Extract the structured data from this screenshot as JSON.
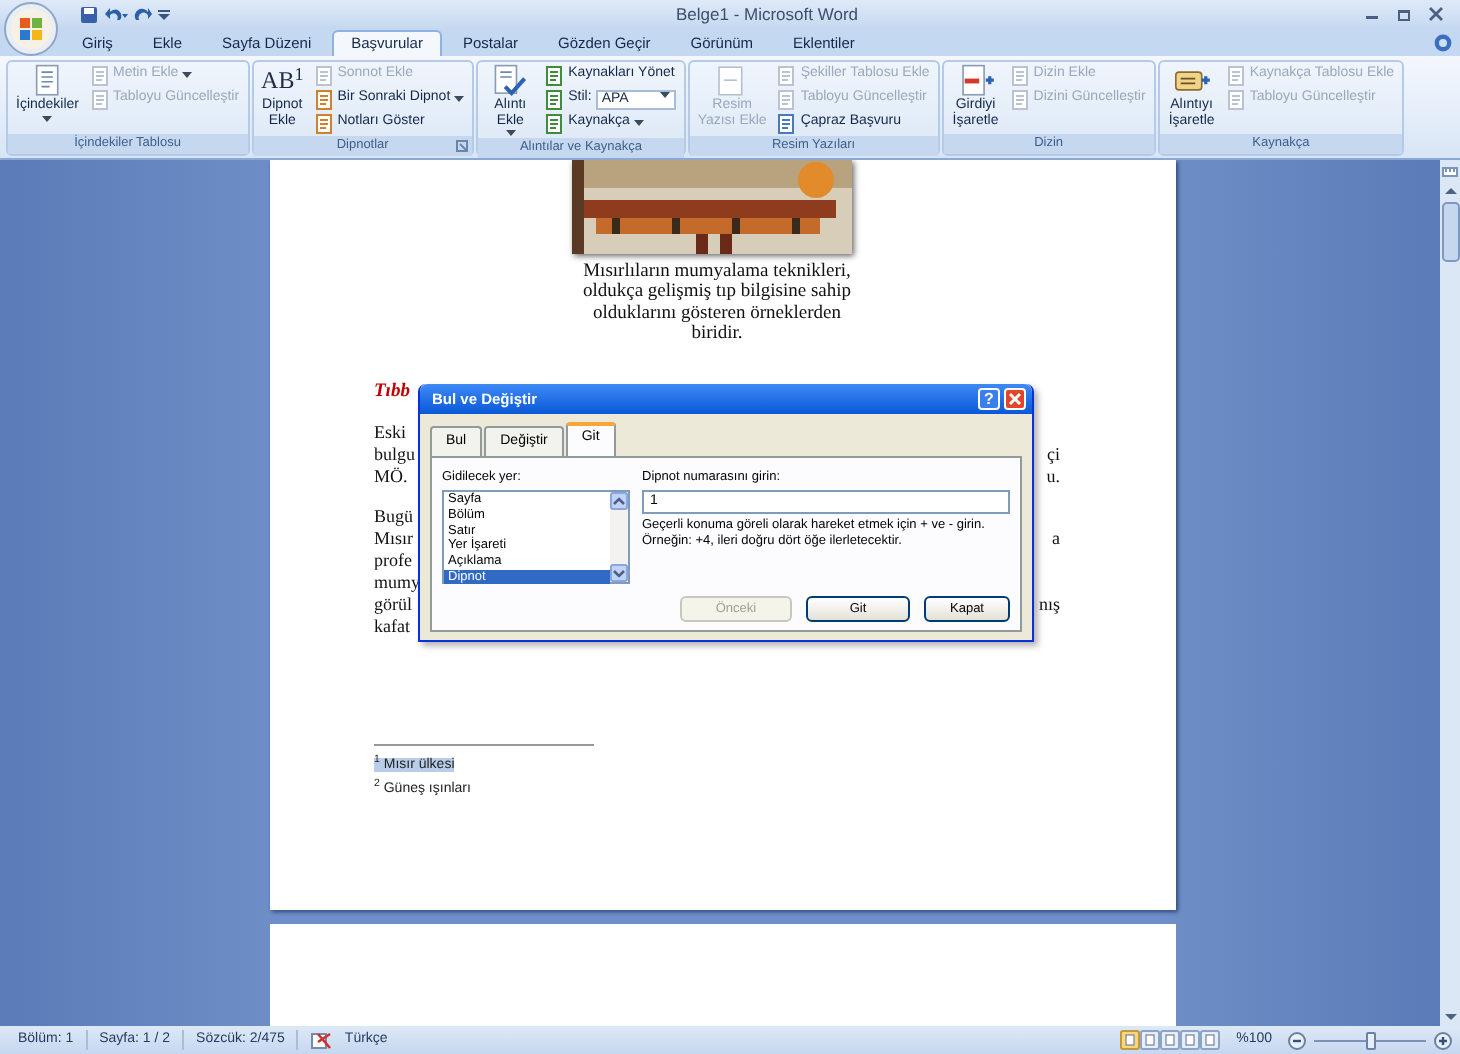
{
  "window": {
    "title": "Belge1 - Microsoft Word"
  },
  "tabs": [
    {
      "label": "Giriş",
      "selected": false
    },
    {
      "label": "Ekle",
      "selected": false
    },
    {
      "label": "Sayfa Düzeni",
      "selected": false
    },
    {
      "label": "Başvurular",
      "selected": true
    },
    {
      "label": "Postalar",
      "selected": false
    },
    {
      "label": "Gözden Geçir",
      "selected": false
    },
    {
      "label": "Görünüm",
      "selected": false
    },
    {
      "label": "Eklentiler",
      "selected": false
    }
  ],
  "ribbon": {
    "groups": [
      {
        "label": "İçindekiler Tablosu",
        "launcher": false,
        "items": [
          {
            "kind": "large",
            "lines": [
              "İçindekiler"
            ],
            "dropdown": true,
            "disabled": false
          },
          {
            "kind": "small",
            "label": "Metin Ekle",
            "dropdown": true,
            "disabled": true
          },
          {
            "kind": "small",
            "label": "Tabloyu Güncelleştir",
            "dropdown": false,
            "disabled": true
          }
        ]
      },
      {
        "label": "Dipnotlar",
        "launcher": true,
        "items": [
          {
            "kind": "large",
            "icon_text": "AB$^{1}$",
            "lines": [
              "Dipnot",
              "Ekle"
            ],
            "dropdown": false,
            "disabled": false
          },
          {
            "kind": "small",
            "label": "Sonnot Ekle",
            "dropdown": false,
            "disabled": true
          },
          {
            "kind": "small",
            "label": "Bir Sonraki Dipnot",
            "dropdown": true,
            "disabled": false
          },
          {
            "kind": "small",
            "label": "Notları Göster",
            "dropdown": false,
            "disabled": false
          }
        ]
      },
      {
        "label": "Alıntılar ve Kaynakça",
        "launcher": false,
        "items": [
          {
            "kind": "large",
            "lines": [
              "Alıntı",
              "Ekle"
            ],
            "dropdown": true,
            "disabled": false
          },
          {
            "kind": "small",
            "label": "Kaynakları Yönet",
            "dropdown": false,
            "disabled": false
          },
          {
            "kind": "combo",
            "label": "Stil:",
            "value": "APA",
            "disabled": false
          },
          {
            "kind": "small",
            "label": "Kaynakça",
            "dropdown": true,
            "disabled": false
          }
        ]
      },
      {
        "label": "Resim Yazıları",
        "launcher": false,
        "items": [
          {
            "kind": "large",
            "lines": [
              "Resim",
              "Yazısı Ekle"
            ],
            "dropdown": false,
            "disabled": true
          },
          {
            "kind": "small",
            "label": "Şekiller Tablosu Ekle",
            "dropdown": false,
            "disabled": true
          },
          {
            "kind": "small",
            "label": "Tabloyu Güncelleştir",
            "dropdown": false,
            "disabled": true
          },
          {
            "kind": "small",
            "label": "Çapraz Başvuru",
            "dropdown": false,
            "disabled": false
          }
        ]
      },
      {
        "label": "Dizin",
        "launcher": false,
        "items": [
          {
            "kind": "large",
            "lines": [
              "Girdiyi",
              "İşaretle"
            ],
            "dropdown": false,
            "disabled": false
          },
          {
            "kind": "small",
            "label": "Dizin Ekle",
            "dropdown": false,
            "disabled": true
          },
          {
            "kind": "small",
            "label": "Dizini Güncelleştir",
            "dropdown": false,
            "disabled": true
          }
        ]
      },
      {
        "label": "Kaynakça",
        "launcher": false,
        "items": [
          {
            "kind": "large",
            "lines": [
              "Alıntıyı",
              "İşaretle"
            ],
            "dropdown": false,
            "disabled": false
          },
          {
            "kind": "small",
            "label": "Kaynakça Tablosu Ekle",
            "dropdown": false,
            "disabled": true
          },
          {
            "kind": "small",
            "label": "Tabloyu Güncelleştir",
            "dropdown": false,
            "disabled": true
          }
        ]
      }
    ]
  },
  "document": {
    "caption_lines": [
      "Mısırlıların mumyalama teknikleri,",
      "oldukça gelişmiş tıp bilgisine sahip",
      "olduklarını gösteren örneklerden",
      "biridir."
    ],
    "heading": "Tıbb",
    "paragraphs": [
      [
        {
          "left": "Eski"
        },
        {
          "left": "bulgu",
          "right": "çi"
        },
        {
          "left": "MÖ.",
          "right": "u."
        }
      ],
      [
        {
          "left": "Bugü"
        },
        {
          "left": "Mısır",
          "right": "a"
        },
        {
          "left": "profe"
        },
        {
          "left": "mumy"
        },
        {
          "left": "görül",
          "right": "nış"
        },
        {
          "left": "kafat"
        }
      ]
    ],
    "footnotes": [
      {
        "mark": "1",
        "text": "Mısır ülkesi",
        "selected": true
      },
      {
        "mark": "2",
        "text": "Güneş ışınları",
        "selected": false
      }
    ]
  },
  "dialog": {
    "title": "Bul ve Değiştir",
    "help_button": "?",
    "tabs": [
      {
        "label": "Bul",
        "selected": false
      },
      {
        "label": "Değiştir",
        "selected": false
      },
      {
        "label": "Git",
        "selected": true
      }
    ],
    "goto_label": "Gidilecek yer:",
    "goto_items": [
      {
        "label": "Sayfa",
        "selected": false
      },
      {
        "label": "Bölüm",
        "selected": false
      },
      {
        "label": "Satır",
        "selected": false
      },
      {
        "label": "Yer İşareti",
        "selected": false
      },
      {
        "label": "Açıklama",
        "selected": false
      },
      {
        "label": "Dipnot",
        "selected": true
      }
    ],
    "number_label": "Dipnot numarasını girin:",
    "number_value": "1",
    "hint": "Geçerli konuma göreli olarak hareket etmek için + ve - girin. Örneğin: +4, ileri doğru dört öğe ilerletecektir.",
    "buttons": [
      {
        "label": "Önceki",
        "disabled": true
      },
      {
        "label": "Git",
        "disabled": false
      },
      {
        "label": "Kapat",
        "disabled": false
      }
    ]
  },
  "status_bar": {
    "items": [
      "Bölüm: 1",
      "Sayfa: 1 / 2",
      "Sözcük: 2/475"
    ],
    "language": "Türkçe",
    "views": [
      {
        "selected": true
      },
      {
        "selected": false
      },
      {
        "selected": false
      },
      {
        "selected": false
      },
      {
        "selected": false
      }
    ],
    "zoom": "%100",
    "zoom_slider": {
      "level": 0.5
    }
  }
}
